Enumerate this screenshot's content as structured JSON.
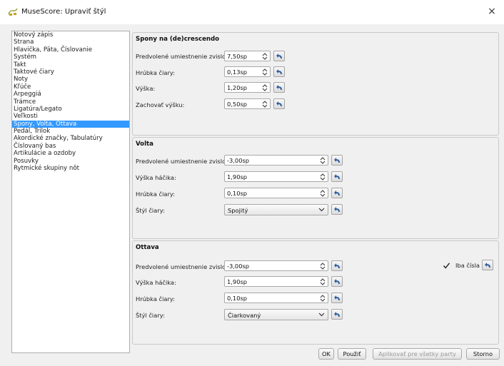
{
  "window": {
    "title": "MuseScore: Upraviť štýl",
    "close_glyph": "×"
  },
  "sidebar": {
    "items": [
      {
        "label": "Notový zápis"
      },
      {
        "label": "Strana"
      },
      {
        "label": "Hlavička, Päta, Číslovanie"
      },
      {
        "label": "Systém"
      },
      {
        "label": "Takt"
      },
      {
        "label": "Taktové čiary"
      },
      {
        "label": "Noty"
      },
      {
        "label": "Kľúče"
      },
      {
        "label": "Arpeggiá"
      },
      {
        "label": "Trámce"
      },
      {
        "label": "Ligatúra/Legato"
      },
      {
        "label": "Veľkosti"
      },
      {
        "label": "Spony, Volta, Ottava"
      },
      {
        "label": "Pedál, Trilok"
      },
      {
        "label": "Akordické značky, Tabulatúry"
      },
      {
        "label": "Číslovaný bas"
      },
      {
        "label": "Artikulácie a ozdoby"
      },
      {
        "label": "Posuvky"
      },
      {
        "label": "Rytmické skupiny nôt"
      }
    ],
    "selected_index": 12
  },
  "hairpin": {
    "title": "Spony na (de)crescendo",
    "rows": [
      {
        "label": "Predvolené umiestnenie zvislo:",
        "value": "7,50sp"
      },
      {
        "label": "Hrúbka čiary:",
        "value": "0,13sp"
      },
      {
        "label": "Výška:",
        "value": "1,20sp"
      },
      {
        "label": "Zachovať výšku:",
        "value": "0,50sp"
      }
    ]
  },
  "volta": {
    "title": "Volta",
    "rows": [
      {
        "label": "Predvolené umiestnenie zvislo:",
        "value": "-3,00sp"
      },
      {
        "label": "Výška háčika:",
        "value": "1,90sp"
      },
      {
        "label": "Hrúbka čiary:",
        "value": "0,10sp"
      }
    ],
    "line_style": {
      "label": "Štýl čiary:",
      "value": "Spojitý"
    }
  },
  "ottava": {
    "title": "Ottava",
    "rows": [
      {
        "label": "Predvolené umiestnenie zvislo:",
        "value": "-3,00sp"
      },
      {
        "label": "Výška háčika:",
        "value": "1,90sp"
      },
      {
        "label": "Hrúbka čiary:",
        "value": "0,10sp"
      }
    ],
    "line_style": {
      "label": "Štýl čiary:",
      "value": "Čiarkovaný"
    },
    "numbers_only": {
      "label": "Iba čísla",
      "checked": true
    }
  },
  "footer": {
    "ok": "OK",
    "apply": "Použiť",
    "apply_all": "Aplikovať pre všetky party",
    "cancel": "Storno"
  },
  "colors": {
    "selection": "#3399ff",
    "panel_bg": "#f0f0f0"
  },
  "icons": {
    "reset": "reset-arrow-icon",
    "spin": "spinbox-arrows-icon",
    "app": "musescore-app-icon"
  }
}
